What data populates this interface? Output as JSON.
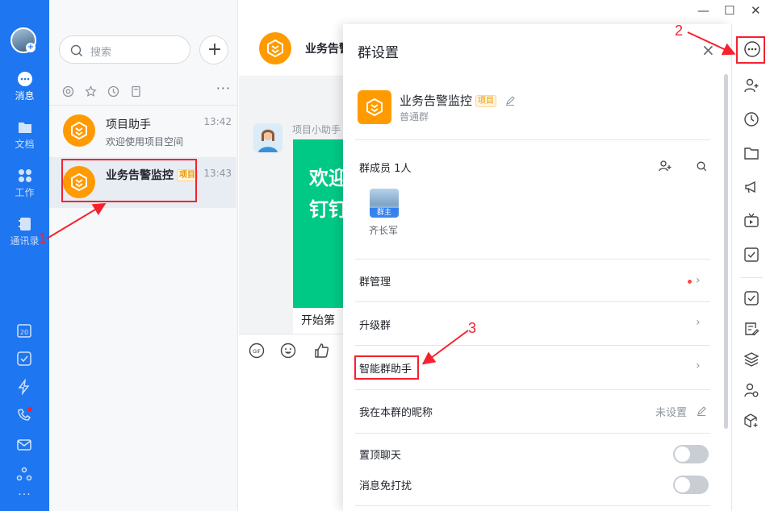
{
  "left_nav": {
    "items": [
      {
        "label": "消息",
        "icon": "message-icon"
      },
      {
        "label": "文档",
        "icon": "doc-icon"
      },
      {
        "label": "工作",
        "icon": "apps-icon"
      },
      {
        "label": "通讯录",
        "icon": "contacts-icon"
      }
    ],
    "bottom_icons": [
      "calendar-icon",
      "todo-icon",
      "flash-icon",
      "video-call-icon",
      "mail-icon",
      "org-icon",
      "more-icon"
    ]
  },
  "search": {
    "placeholder": "搜索"
  },
  "conversations": [
    {
      "name": "项目助手",
      "subtitle": "欢迎使用项目空间",
      "time": "13:42",
      "tag": ""
    },
    {
      "name": "业务告警监控",
      "subtitle": "",
      "time": "13:43",
      "tag": "项目"
    }
  ],
  "chat": {
    "title": "业务告警",
    "sender": "项目小助手",
    "card_line1": "欢迎",
    "card_line2": "钉钉",
    "card_cut": "开始第"
  },
  "settings": {
    "title": "群设置",
    "close": "×",
    "group_name": "业务告警监控",
    "group_tag": "项目",
    "group_type": "普通群",
    "members_label": "群成员 1人",
    "member_badge": "群主",
    "member_name": "齐长军",
    "rows": {
      "manage": "群管理",
      "upgrade": "升级群",
      "assistant": "智能群助手",
      "nickname": "我在本群的昵称",
      "nickname_value": "未设置",
      "pin": "置顶聊天",
      "mute": "消息免打扰"
    },
    "accent_dot_color": "#f54a45"
  },
  "annotations": {
    "n1": "1",
    "n2": "2",
    "n3": "3"
  },
  "window": {
    "minimize": "—",
    "maximize": "☐",
    "close": "✕"
  }
}
